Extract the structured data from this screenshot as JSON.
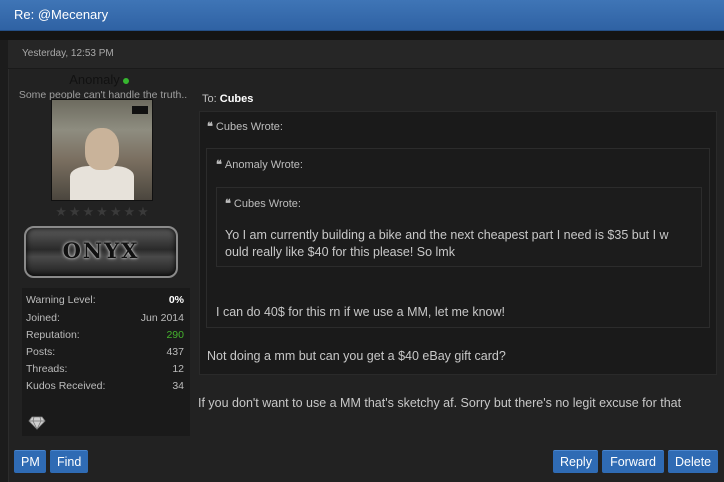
{
  "window": {
    "title": "Re: @Mecenary"
  },
  "post": {
    "date": "Yesterday, 12:53 PM",
    "to_label": "To:",
    "to_user": "Cubes",
    "reply_text": "If you don't want to use a MM that's sketchy af. Sorry but there's no legit excuse for that"
  },
  "user": {
    "name": "Anomaly",
    "title": "Some people can't handle the truth..",
    "rank": "ONYX",
    "stars": "★★★★★★★",
    "stats": [
      {
        "label": "Warning Level:",
        "value": "0%"
      },
      {
        "label": "Joined:",
        "value": "Jun 2014"
      },
      {
        "label": "Reputation:",
        "value": "290"
      },
      {
        "label": "Posts:",
        "value": "437"
      },
      {
        "label": "Threads:",
        "value": "12"
      },
      {
        "label": "Kudos Received:",
        "value": "34"
      }
    ]
  },
  "quotes": {
    "outer_header": "Cubes Wrote:",
    "outer_text": "Not doing a mm but can you get a $40 eBay gift card?",
    "middle_header": "Anomaly Wrote:",
    "middle_text": "I can do 40$ for this rn if we use a MM, let me know!",
    "inner_header": "Cubes Wrote:",
    "inner_text_line1": "Yo I am currently building a bike and the next cheapest part I need is $35 but I w",
    "inner_text_line2": "ould really like $40 for this please! So lmk"
  },
  "buttons": {
    "pm": "PM",
    "find": "Find",
    "reply": "Reply",
    "forward": "Forward",
    "delete": "Delete"
  },
  "colors": {
    "accent": "#2f6bb4",
    "online": "#36b62f",
    "reputation": "#45b22d"
  }
}
